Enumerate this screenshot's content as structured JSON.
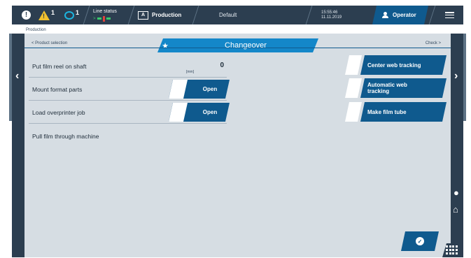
{
  "topbar": {
    "alert_count": "1",
    "message_count": "1",
    "line_status_label": "Line status",
    "production_label": "Production",
    "production_icon_text": "A",
    "default_label": "Default",
    "time": "15:55:46",
    "date": "11.11.2019",
    "operator_label": "Operator",
    "icons": [
      "info-icon",
      "warning-icon",
      "message-icon",
      "user-icon",
      "menu-icon"
    ],
    "status_colors": {
      "green": "#3ac96b",
      "red": "#e0443c",
      "warning": "#f2c12e"
    }
  },
  "breadcrumb": "Production",
  "panel": {
    "back_link": "< Product selection",
    "next_link": "Check >",
    "tab_title": "Changeover",
    "tab_icon": "star-icon"
  },
  "rows": [
    {
      "label": "Put film reel on shaft",
      "unit": "[mm]",
      "value": "0"
    },
    {
      "label": "Mount format parts",
      "button": "Open"
    },
    {
      "label": "Load overprinter job",
      "button": "Open"
    },
    {
      "label": "Pull film through machine"
    }
  ],
  "actions": [
    {
      "label": "Center web tracking"
    },
    {
      "label": "Automatic web tracking"
    },
    {
      "label": "Make film tube"
    }
  ],
  "colors": {
    "accent": "#1487c9",
    "dark_blue": "#0f5a8e",
    "chrome": "#2c3e50",
    "panel": "#d6dde3"
  }
}
